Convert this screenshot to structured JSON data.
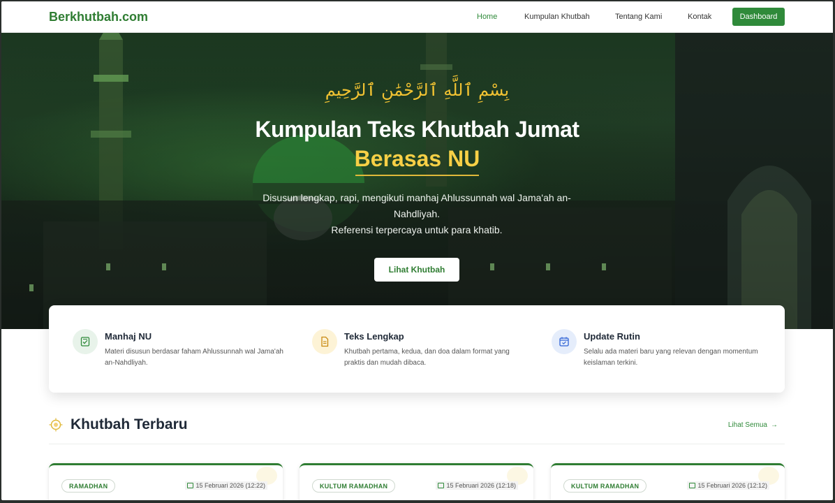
{
  "nav": {
    "brand": "Berkhutbah.com",
    "links": [
      "Home",
      "Kumpulan Khutbah",
      "Tentang Kami",
      "Kontak"
    ],
    "dashboard": "Dashboard"
  },
  "hero": {
    "arabic": "بِسْمِ ٱللَّهِ ٱلرَّحْمَٰنِ ٱلرَّحِيمِ",
    "title": "Kumpulan Teks Khutbah Jumat",
    "accent": "Berasas NU",
    "desc_line1": "Disusun lengkap, rapi, mengikuti manhaj Ahlussunnah wal Jama'ah an-Nahdliyah.",
    "desc_line2": "Referensi terpercaya untuk para khatib.",
    "button": "Lihat Khutbah"
  },
  "features": [
    {
      "title": "Manhaj NU",
      "desc": "Materi disusun berdasar faham Ahlussunnah wal Jama'ah an-Nahdliyah.",
      "icon": "checklist-icon",
      "color": "#e8f3ea"
    },
    {
      "title": "Teks Lengkap",
      "desc": "Khutbah pertama, kedua, dan doa dalam format yang praktis dan mudah dibaca.",
      "icon": "document-icon",
      "color": "#fdf3d6"
    },
    {
      "title": "Update Rutin",
      "desc": "Selalu ada materi baru yang relevan dengan momentum keislaman terkini.",
      "icon": "calendar-check-icon",
      "color": "#e5edfb"
    }
  ],
  "section": {
    "title": "Khutbah Terbaru",
    "see_all": "Lihat Semua",
    "arrow": "→"
  },
  "cards": [
    {
      "category": "RAMADHAN",
      "date": "15 Februari 2026 (12:22)"
    },
    {
      "category": "KULTUM RAMADHAN",
      "date": "15 Februari 2026 (12:18)"
    },
    {
      "category": "KULTUM RAMADHAN",
      "date": "15 Februari 2026 (12:12)"
    }
  ],
  "colors": {
    "brand": "#2f7d32",
    "accent_yellow": "#f7d046"
  }
}
